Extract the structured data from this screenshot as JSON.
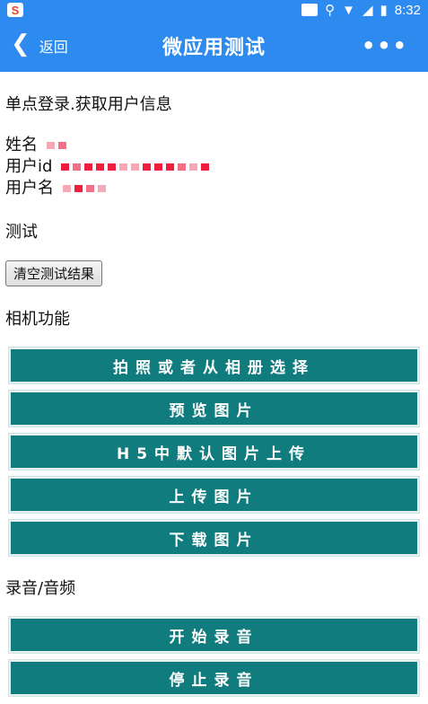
{
  "status": {
    "time": "8:32",
    "app_badge": "S"
  },
  "nav": {
    "back": "返回",
    "title": "微应用测试",
    "more": "•••"
  },
  "sso_title": "单点登录.获取用户信息",
  "user": {
    "name_label": "姓名",
    "id_label": "用户id",
    "username_label": "用户名"
  },
  "test_title": "测试",
  "clear_label": "清空测试结果",
  "camera": {
    "title": "相机功能",
    "buttons": [
      "拍照或者从相册选择",
      "预览图片",
      "H5中默认图片上传",
      "上传图片",
      "下载图片"
    ]
  },
  "audio": {
    "title": "录音/音频",
    "buttons": [
      "开始录音",
      "停止录音"
    ]
  }
}
